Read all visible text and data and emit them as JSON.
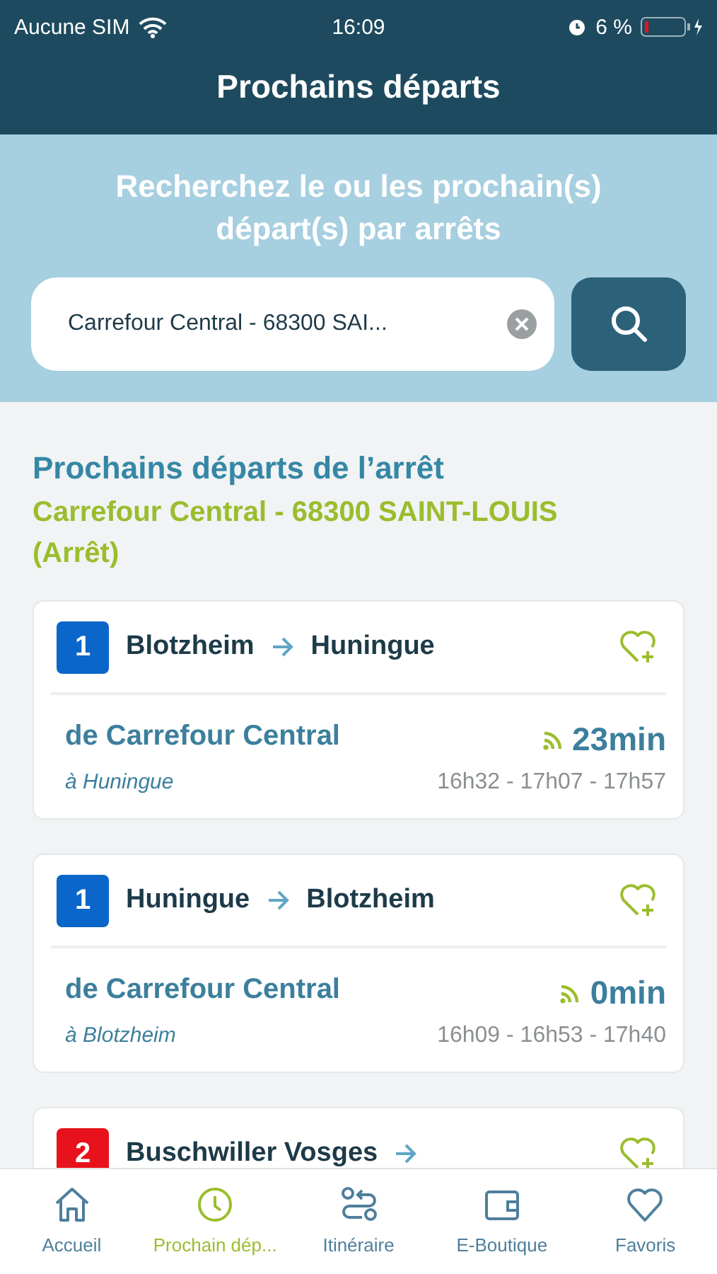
{
  "status_bar": {
    "carrier": "Aucune SIM",
    "time": "16:09",
    "battery": "6 %"
  },
  "header": {
    "title": "Prochains départs"
  },
  "search": {
    "prompt": "Recherchez le ou les prochain(s) départ(s) par arrêts",
    "value": "Carrefour Central - 68300 SAI..."
  },
  "results": {
    "heading": "Prochains départs de l’arrêt",
    "stop": "Carrefour Central - 68300 SAINT-LOUIS (Arrêt)",
    "departures": [
      {
        "line": "1",
        "color": "#0a66c8",
        "from": "Blotzheim",
        "to": "Huningue",
        "stop": "de Carrefour Central",
        "direction": "à Huningue",
        "wait": "23min",
        "times": "16h32 - 17h07 - 17h57"
      },
      {
        "line": "1",
        "color": "#0a66c8",
        "from": "Huningue",
        "to": "Blotzheim",
        "stop": "de Carrefour Central",
        "direction": "à Blotzheim",
        "wait": "0min",
        "times": "16h09 - 16h53 - 17h40"
      },
      {
        "line": "2",
        "color": "#e8121c",
        "from": "Buschwiller Vosges"
      }
    ]
  },
  "tab_bar": [
    {
      "label": "Accueil",
      "selected": false
    },
    {
      "label": "Prochain dép...",
      "selected": true
    },
    {
      "label": "Itinéraire",
      "selected": false
    },
    {
      "label": "E-Boutique",
      "selected": false
    },
    {
      "label": "Favoris",
      "selected": false
    }
  ]
}
